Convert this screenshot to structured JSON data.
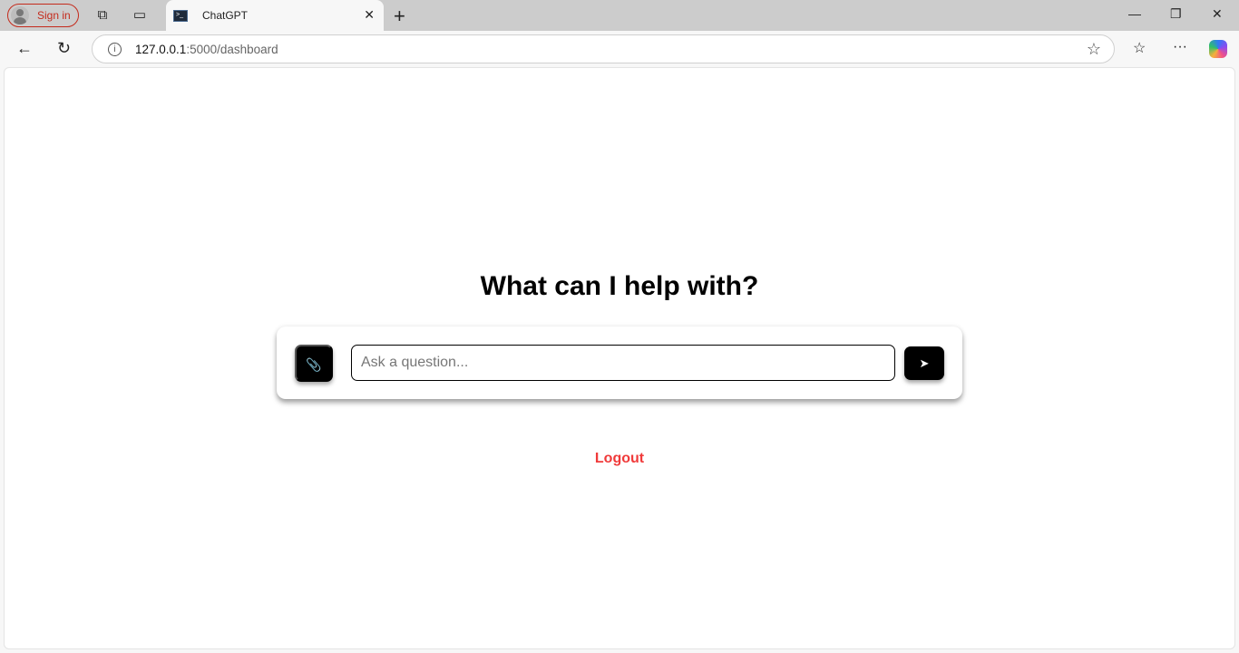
{
  "browser": {
    "signin_label": "Sign in",
    "tab_title": "ChatGPT",
    "url_host": "127.0.0.1",
    "url_path": ":5000/dashboard"
  },
  "main": {
    "heading": "What can I help with?",
    "input_placeholder": "Ask a question...",
    "attach_icon": "paperclip-icon",
    "send_icon": "send-arrow-icon",
    "logout_label": "Logout",
    "logout_color": "#f03a3a"
  }
}
